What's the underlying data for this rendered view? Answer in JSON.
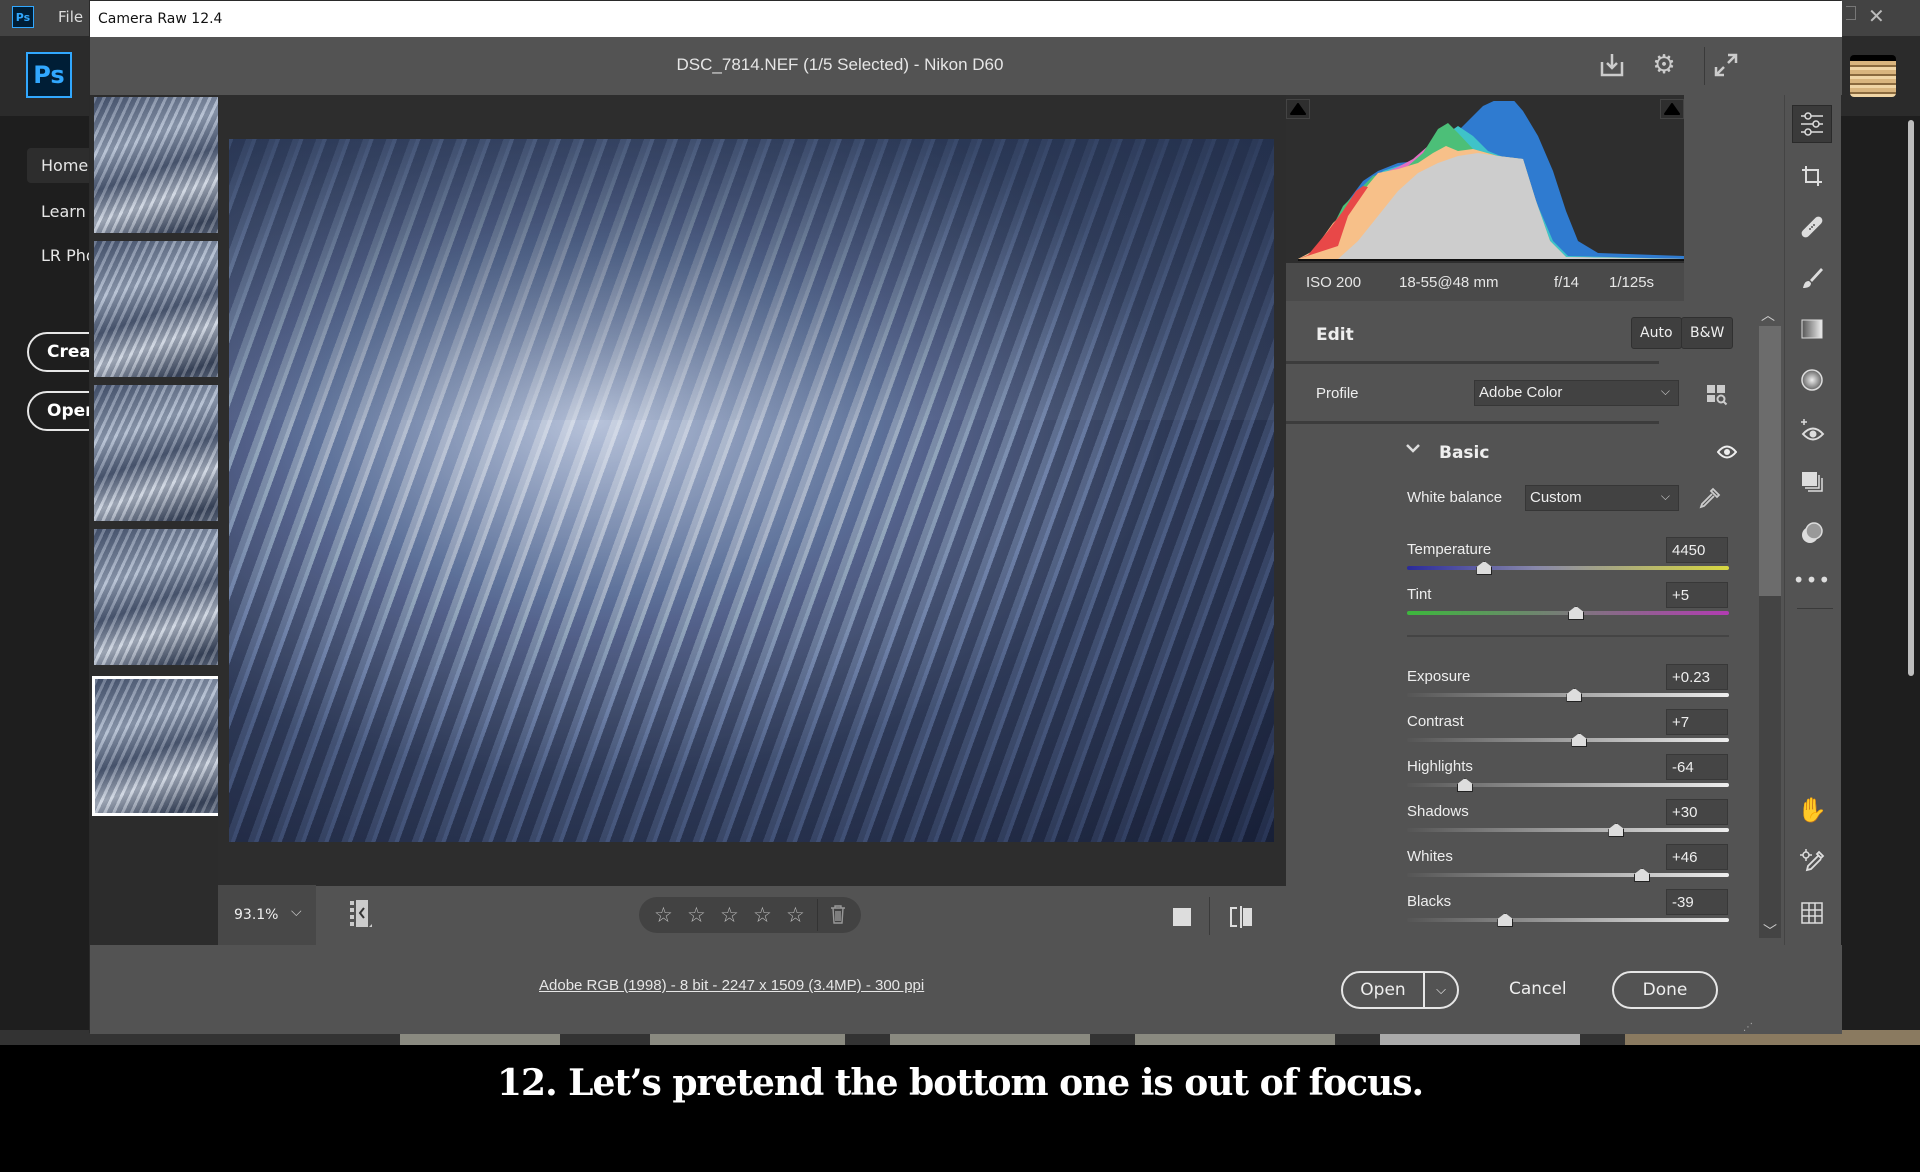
{
  "photoshop": {
    "logo": "Ps",
    "menu_file": "File",
    "close_glyph": "✕",
    "home_nav": [
      "Home",
      "Learn",
      "LR Pho"
    ],
    "home_buttons": [
      "Creat",
      "Open"
    ]
  },
  "dialog": {
    "window_title": "Camera Raw 12.4",
    "header_title": "DSC_7814.NEF (1/5 Selected)  -  Nikon D60",
    "header_icons": [
      "save-icon",
      "gear-icon",
      "expand-icon"
    ]
  },
  "filmstrip": {
    "count": 5,
    "selected_index": 4
  },
  "preview_toolbar": {
    "zoom": "93.1%",
    "rating_stars": 0,
    "star_glyph": "☆",
    "trash_glyph": "🗑"
  },
  "footer": {
    "file_info": "Adobe RGB (1998) - 8 bit - 2247 x 1509 (3.4MP) - 300 ppi",
    "open_label": "Open",
    "cancel_label": "Cancel",
    "done_label": "Done"
  },
  "camera_info": {
    "iso": "ISO 200",
    "lens": "18-55@48 mm",
    "aperture": "f/14",
    "shutter": "1/125s"
  },
  "edit": {
    "title": "Edit",
    "auto_label": "Auto",
    "bw_label": "B&W",
    "profile_label": "Profile",
    "profile_value": "Adobe Color",
    "basic_title": "Basic",
    "wb_label": "White balance",
    "wb_value": "Custom",
    "sliders": [
      {
        "name": "Temperature",
        "value": "4450",
        "fraction": 0.24,
        "track": "temp"
      },
      {
        "name": "Tint",
        "value": "+5",
        "fraction": 0.525,
        "track": "tint"
      },
      {
        "name": "Exposure",
        "value": "+0.23",
        "fraction": 0.52,
        "track": "gray"
      },
      {
        "name": "Contrast",
        "value": "+7",
        "fraction": 0.535,
        "track": "gray"
      },
      {
        "name": "Highlights",
        "value": "-64",
        "fraction": 0.18,
        "track": "gray"
      },
      {
        "name": "Shadows",
        "value": "+30",
        "fraction": 0.65,
        "track": "gray"
      },
      {
        "name": "Whites",
        "value": "+46",
        "fraction": 0.73,
        "track": "gray"
      },
      {
        "name": "Blacks",
        "value": "-39",
        "fraction": 0.305,
        "track": "gray"
      }
    ]
  },
  "tool_rail": [
    "edit-sliders-icon",
    "crop-icon",
    "healing-icon",
    "brush-icon",
    "linear-gradient-icon",
    "radial-gradient-icon",
    "red-eye-icon",
    "snapshots-icon",
    "presets-icon",
    "more-icon",
    "hand-icon",
    "color-sampler-icon",
    "grid-icon"
  ],
  "colors": {
    "dialog_bg": "#535353",
    "panel_dark": "#2e2e2e",
    "ps_blue": "#31a8ff"
  },
  "caption": "12. Let’s pretend the bottom one is out of focus."
}
